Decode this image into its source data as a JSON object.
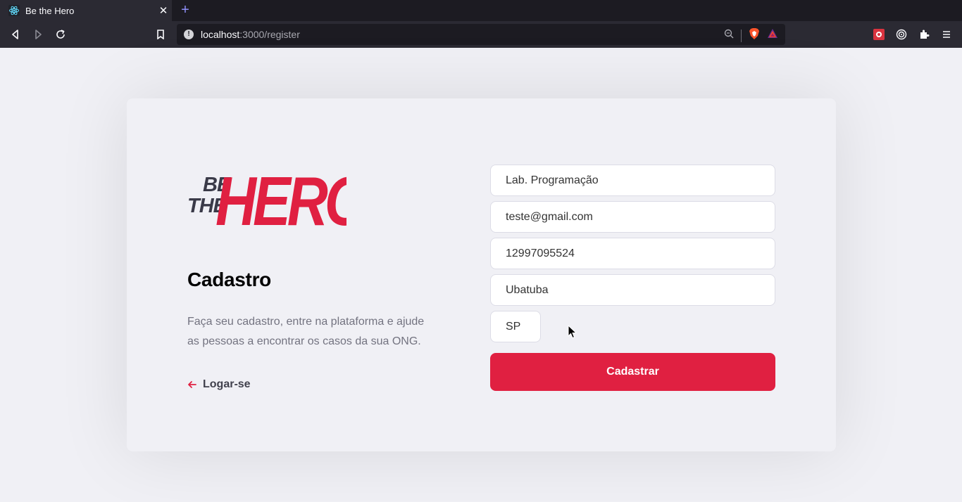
{
  "browser": {
    "tab_title": "Be the Hero",
    "tab_close": "✕",
    "new_tab": "+",
    "url_host": "localhost",
    "url_path": ":3000/register"
  },
  "page": {
    "logo_alt": "Be the Hero",
    "logo_be": "BE",
    "logo_the": "THE",
    "logo_hero": "HERO",
    "title": "Cadastro",
    "description": "Faça seu cadastro, entre na plataforma e ajude as pessoas a encontrar os casos da sua ONG.",
    "back_link": "Logar-se"
  },
  "form": {
    "name_value": "Lab. Programação",
    "email_value": "teste@gmail.com",
    "whatsapp_value": "12997095524",
    "city_value": "Ubatuba",
    "uf_value": "SP",
    "submit_label": "Cadastrar"
  },
  "colors": {
    "accent": "#e02041",
    "background": "#f0f0f5",
    "text_muted": "#737380",
    "text_dark": "#41414d"
  }
}
